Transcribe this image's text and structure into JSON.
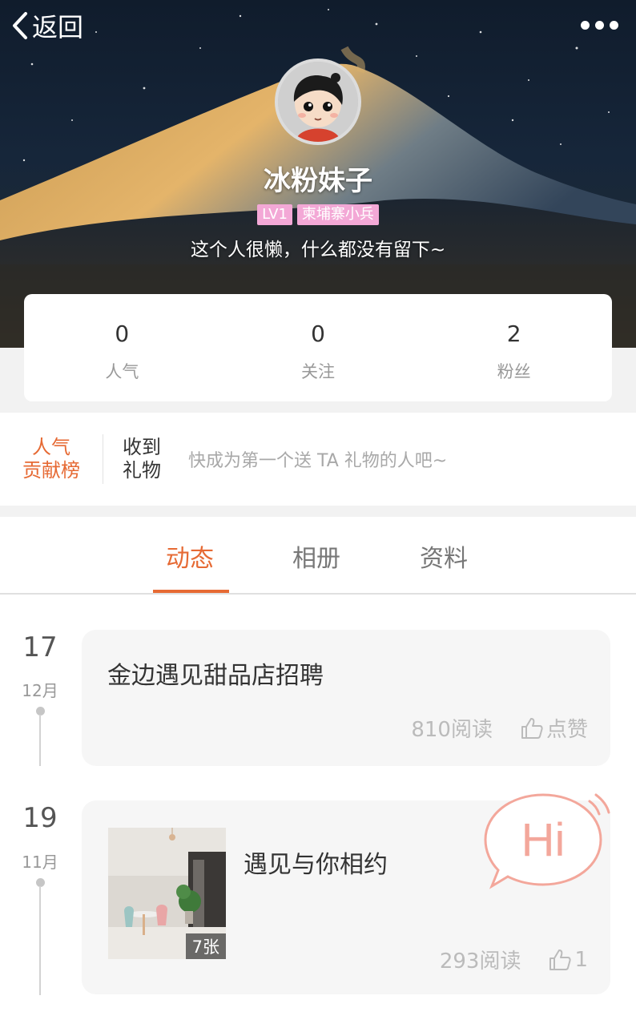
{
  "header": {
    "back_label": "返回",
    "nickname": "冰粉妹子",
    "badges": [
      "LV1",
      "柬埔寨小兵"
    ],
    "bio": "这个人很懒，什么都没有留下~"
  },
  "stats": [
    {
      "value": "0",
      "label": "人气"
    },
    {
      "value": "0",
      "label": "关注"
    },
    {
      "value": "2",
      "label": "粉丝"
    }
  ],
  "gift": {
    "rank_line1": "人气",
    "rank_line2": "贡献榜",
    "received_line1": "收到",
    "received_line2": "礼物",
    "tip": "快成为第一个送 TA 礼物的人吧~"
  },
  "tabs": [
    "动态",
    "相册",
    "资料"
  ],
  "active_tab": "动态",
  "posts": [
    {
      "day": "17",
      "month": "12月",
      "title": "金边遇见甜品店招聘",
      "reads": "810阅读",
      "like_label": "点赞"
    },
    {
      "day": "19",
      "month": "11月",
      "title": "遇见与你相约",
      "reads": "293阅读",
      "like_label": "1",
      "photo_count": "7张"
    }
  ],
  "hi_bubble": {
    "text": "Hi"
  },
  "colors": {
    "accent": "#e66a34",
    "badge": "#f3a8d6",
    "hi": "#f3a79b"
  }
}
